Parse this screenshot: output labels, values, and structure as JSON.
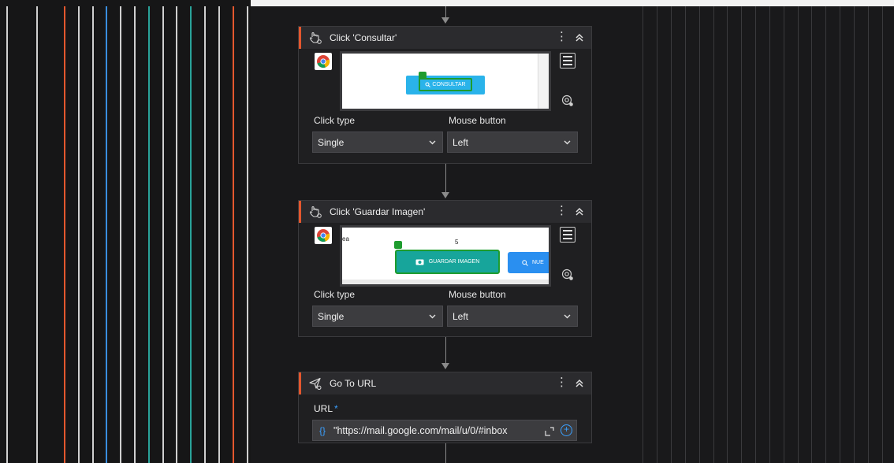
{
  "cards": [
    {
      "title": "Click 'Consultar'",
      "preview_text": "CONSULTAR",
      "click_type_label": "Click type",
      "click_type_value": "Single",
      "mouse_button_label": "Mouse button",
      "mouse_button_value": "Left"
    },
    {
      "title": "Click 'Guardar Imagen'",
      "preview_text": "GUARDAR IMAGEN",
      "preview_number": "5",
      "preview_partial": "ea",
      "preview_next": "NUE",
      "click_type_label": "Click type",
      "click_type_value": "Single",
      "mouse_button_label": "Mouse button",
      "mouse_button_value": "Left"
    },
    {
      "title": "Go To URL",
      "url_label": "URL",
      "url_required": "*",
      "url_brace": "{}",
      "url_value": "\"https://mail.google.com/mail/u/0/#inbox"
    }
  ],
  "header_menu_glyph": "⋮",
  "url_plus_glyph": "+",
  "colors": {
    "accent_orange": "#e4572e",
    "accent_blue": "#3aa0ff",
    "selection_green": "#1e9c2e",
    "preview_button": "#2ab3ea",
    "panel_bg": "#1f1f21",
    "header_bg": "#2b2b2e"
  },
  "icons": {
    "click": "hand-pointer-icon",
    "goto_url": "send-url-icon",
    "browser": "chrome-icon",
    "menu": "kebab-menu-icon",
    "collapse": "chevron-double-up-icon",
    "side_list": "list-icon",
    "target": "target-icon",
    "select": "chevron-down-icon",
    "expand": "expand-icon",
    "add": "add-circle-icon"
  }
}
